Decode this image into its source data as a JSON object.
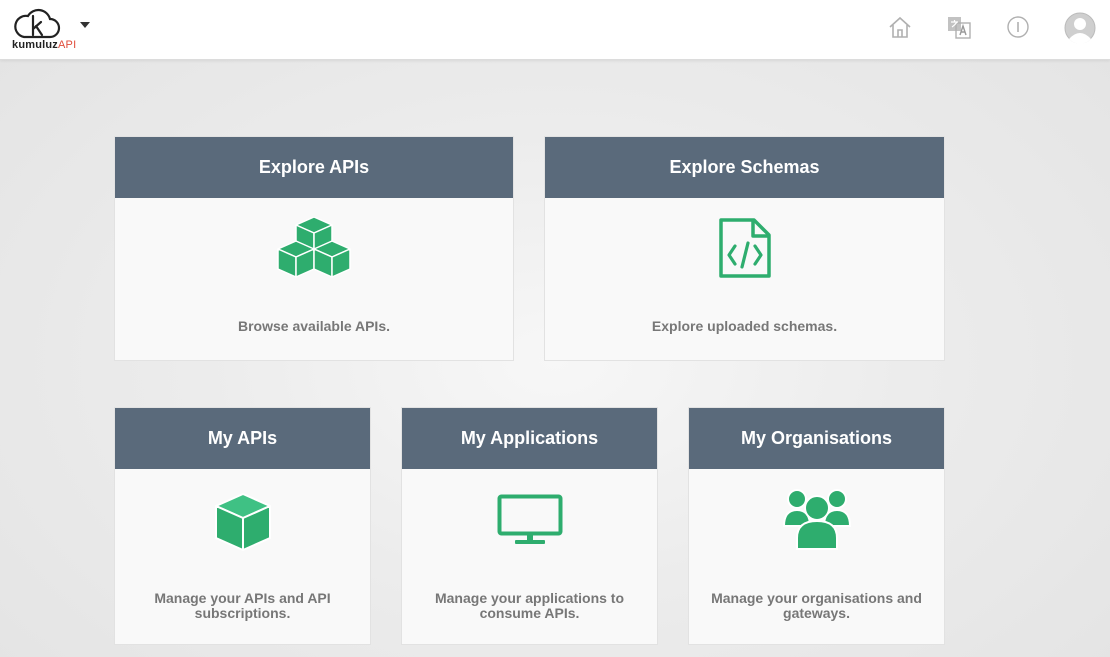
{
  "brand": {
    "name": "kumuluz",
    "suffix": "API"
  },
  "colors": {
    "header_bg": "#5a6a7b",
    "accent_green": "#2ead6e",
    "logo_red": "#e04b3a"
  },
  "nav_icons": [
    "home-icon",
    "translate-icon",
    "info-icon",
    "user-avatar-icon"
  ],
  "cards": [
    {
      "title": "Explore APIs",
      "icon": "cubes-icon",
      "description": "Browse available APIs."
    },
    {
      "title": "Explore Schemas",
      "icon": "code-file-icon",
      "description": "Explore uploaded schemas."
    },
    {
      "title": "My APIs",
      "icon": "cube-icon",
      "description": "Manage your APIs and API subscriptions."
    },
    {
      "title": "My Applications",
      "icon": "monitor-icon",
      "description": "Manage your applications to consume APIs."
    },
    {
      "title": "My Organisations",
      "icon": "users-icon",
      "description": "Manage your organisations and gateways."
    }
  ]
}
